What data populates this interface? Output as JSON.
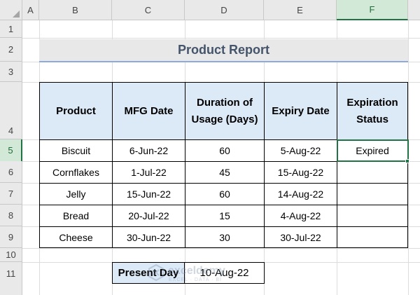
{
  "sheet": {
    "corner_icon": "select-all-triangle-icon",
    "columns": [
      "A",
      "B",
      "C",
      "D",
      "E",
      "F"
    ],
    "rows": [
      "1",
      "2",
      "3",
      "4",
      "5",
      "6",
      "7",
      "8",
      "9",
      "10",
      "11"
    ],
    "selected_column": "F",
    "selected_row": "5"
  },
  "report": {
    "title": "Product Report",
    "title_color": "#44546a",
    "band_color": "#e8e8e8",
    "underline_color": "#8ea9db"
  },
  "table": {
    "header_color": "#dce9f7",
    "headers": [
      "Product",
      "MFG Date",
      "Duration of Usage (Days)",
      "Expiry Date",
      "Expiration Status"
    ],
    "rows": [
      {
        "product": "Biscuit",
        "mfg": "6-Jun-22",
        "duration": "60",
        "expiry": "5-Aug-22",
        "status": "Expired"
      },
      {
        "product": "Cornflakes",
        "mfg": "1-Jul-22",
        "duration": "45",
        "expiry": "15-Aug-22",
        "status": ""
      },
      {
        "product": "Jelly",
        "mfg": "15-Jun-22",
        "duration": "60",
        "expiry": "14-Aug-22",
        "status": ""
      },
      {
        "product": "Bread",
        "mfg": "20-Jul-22",
        "duration": "15",
        "expiry": "4-Aug-22",
        "status": ""
      },
      {
        "product": "Cheese",
        "mfg": "30-Jun-22",
        "duration": "30",
        "expiry": "30-Jul-22",
        "status": ""
      }
    ]
  },
  "present_day": {
    "label": "Present Day",
    "value": "10-Aug-22"
  },
  "watermark": {
    "text": "exceldemy",
    "subtext": "EXCEL · DATA · BI"
  },
  "selection_color": "#217346"
}
